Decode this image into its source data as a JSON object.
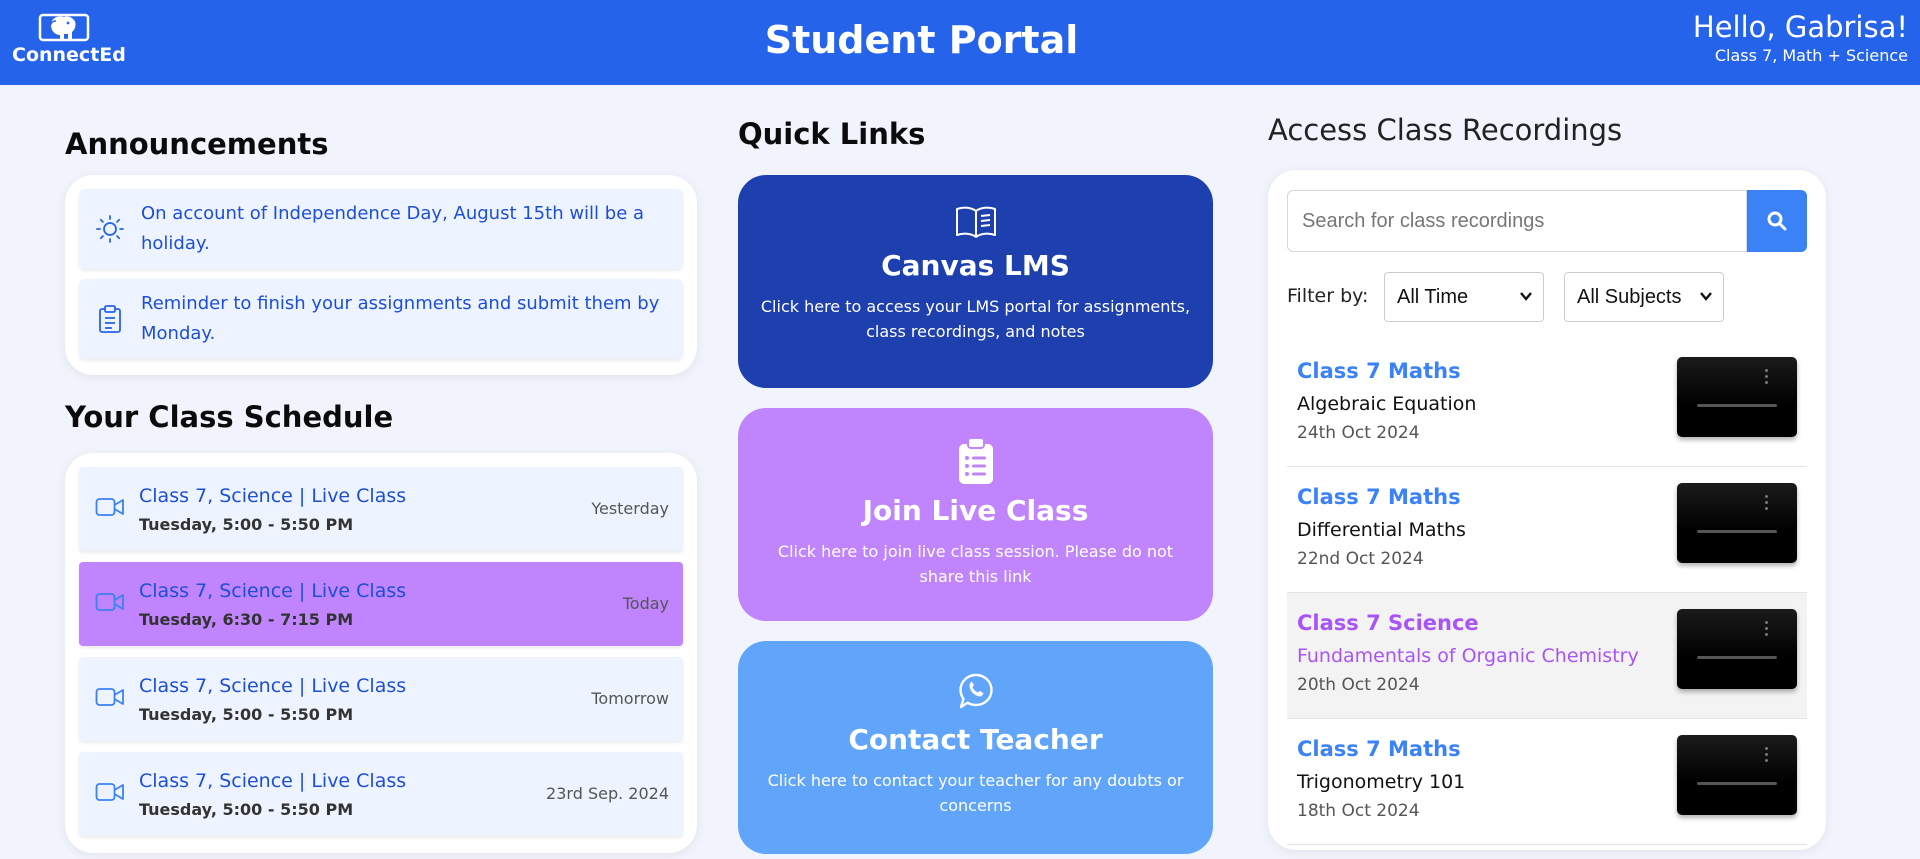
{
  "header": {
    "logo_text": "ConnectEd",
    "title": "Student Portal",
    "greeting": "Hello, Gabrisa!",
    "subtitle": "Class 7, Math + Science"
  },
  "announcements": {
    "title": "Announcements",
    "items": [
      {
        "icon": "sun-icon",
        "text": "On account of Independence Day, August 15th will be a holiday."
      },
      {
        "icon": "clipboard-icon",
        "text": "Reminder to finish your assignments and submit them by Monday."
      }
    ]
  },
  "schedule": {
    "title": "Your Class Schedule",
    "items": [
      {
        "title": "Class 7, Science | Live Class",
        "time": "Tuesday, 5:00 - 5:50 PM",
        "day": "Yesterday",
        "active": false
      },
      {
        "title": "Class 7, Science | Live Class",
        "time": "Tuesday, 6:30 - 7:15 PM",
        "day": "Today",
        "active": true
      },
      {
        "title": "Class 7, Science | Live Class",
        "time": "Tuesday, 5:00 - 5:50 PM",
        "day": "Tomorrow",
        "active": false
      },
      {
        "title": "Class 7, Science | Live Class",
        "time": "Tuesday, 5:00 - 5:50 PM",
        "day": "23rd Sep. 2024",
        "active": false
      }
    ]
  },
  "quick_links": {
    "title": "Quick Links",
    "cards": [
      {
        "icon": "book-icon",
        "title": "Canvas LMS",
        "desc": "Click here to access your LMS portal for assignments, class recordings, and notes",
        "color": "#1e40af"
      },
      {
        "icon": "clipboard-list-icon",
        "title": "Join Live Class",
        "desc": "Click here to join live class session. Please do not share this link",
        "color": "#c084fc"
      },
      {
        "icon": "whatsapp-icon",
        "title": "Contact Teacher",
        "desc": "Click here to contact your teacher for any doubts or concerns",
        "color": "#60a5fa"
      }
    ]
  },
  "recordings": {
    "title": "Access Class Recordings",
    "search_placeholder": "Search for class recordings",
    "filter_label": "Filter by:",
    "time_filter": "All Time",
    "subject_filter": "All Subjects",
    "items": [
      {
        "class": "Class 7 Maths",
        "topic": "Algebraic Equation",
        "date": "24th Oct 2024",
        "active": false
      },
      {
        "class": "Class 7 Maths",
        "topic": "Differential Maths",
        "date": "22nd Oct 2024",
        "active": false
      },
      {
        "class": "Class 7 Science",
        "topic": "Fundamentals of Organic Chemistry",
        "date": "20th Oct 2024",
        "active": true
      },
      {
        "class": "Class 7 Maths",
        "topic": "Trigonometry 101",
        "date": "18th Oct 2024",
        "active": false
      }
    ]
  },
  "colors": {
    "primary": "#2563eb",
    "accent_purple": "#c084fc",
    "link_blue": "#1d4ed8",
    "background": "#f1f3fd"
  }
}
